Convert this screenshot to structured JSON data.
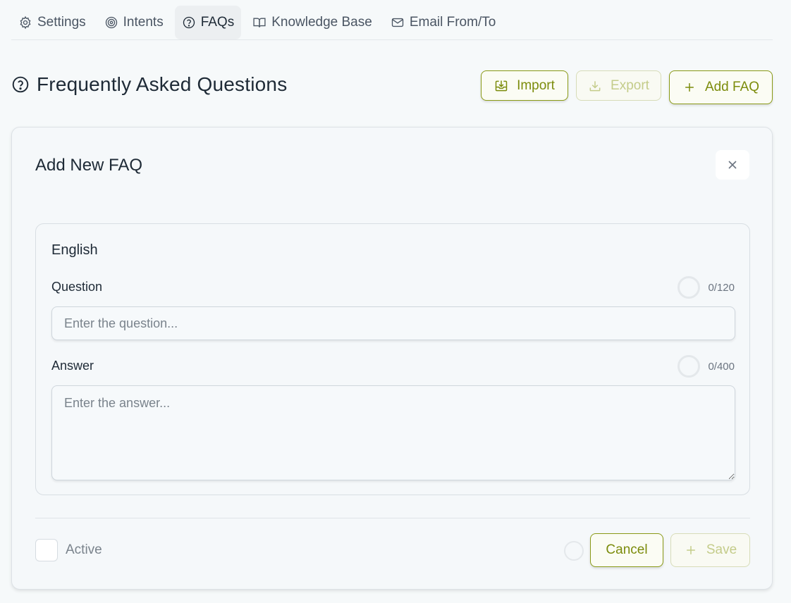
{
  "tabs": [
    {
      "label": "Settings",
      "icon": "gear-icon"
    },
    {
      "label": "Intents",
      "icon": "target-icon"
    },
    {
      "label": "FAQs",
      "icon": "question-circle-icon",
      "active": true
    },
    {
      "label": "Knowledge Base",
      "icon": "book-icon"
    },
    {
      "label": "Email From/To",
      "icon": "mail-icon"
    }
  ],
  "header": {
    "title": "Frequently Asked Questions",
    "import_label": "Import",
    "export_label": "Export",
    "add_faq_label": "Add FAQ"
  },
  "form": {
    "title": "Add New FAQ",
    "language": "English",
    "question_label": "Question",
    "question_counter": "0/120",
    "question_placeholder": "Enter the question...",
    "question_value": "",
    "answer_label": "Answer",
    "answer_counter": "0/400",
    "answer_placeholder": "Enter the answer...",
    "answer_value": "",
    "active_label": "Active",
    "active_checked": false,
    "cancel_label": "Cancel",
    "save_label": "Save"
  },
  "colors": {
    "accent": "#7c8c0c",
    "accent_disabled": "#c4cc8a",
    "background": "#f6f9fa",
    "text": "#1e2a36"
  }
}
